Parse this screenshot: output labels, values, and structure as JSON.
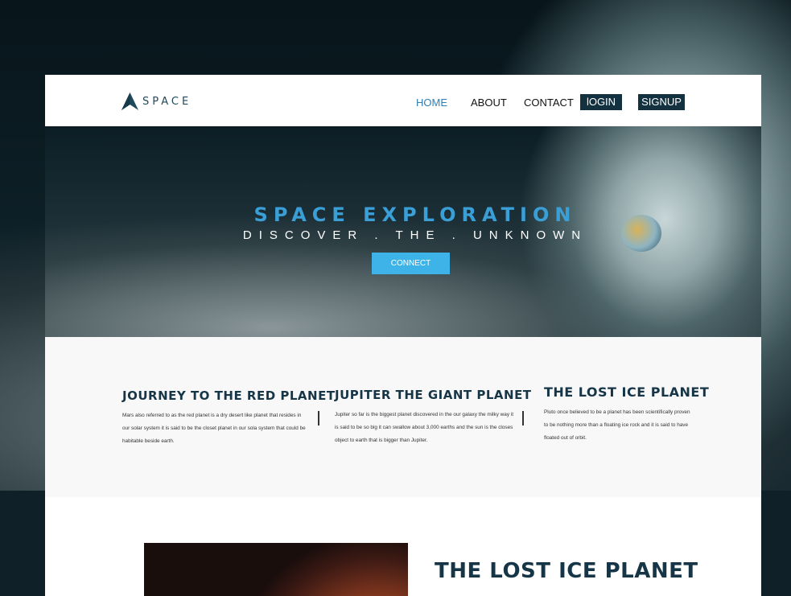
{
  "brand": {
    "logo_icon": "rocket-a-icon",
    "name": "SPACE",
    "color": "#20495a"
  },
  "nav": {
    "links": [
      "HOME",
      "ABOUT",
      "CONTACT"
    ],
    "active": "HOME",
    "login_label": "lOGIN",
    "signup_label": "SIGNUP"
  },
  "hero": {
    "title": "SPACE EXPLORATION",
    "subtitle": "DISCOVER . THE . UNKNOWN",
    "cta_label": "CONNECT"
  },
  "features": [
    {
      "title": "JOURNEY TO THE RED PLANET",
      "body": "Mars also referred to as the red planet is a dry desert like planet that resides in our solar system it is said to be the closet planet in our sola system that could be habitable beside earth."
    },
    {
      "title": "JUPITER THE GIANT PLANET",
      "body": "Jupiter so far is the biggest planet discovered in the our galaxy the milky way it is said to be so big it can swallow about 3,000 earths and the sun is the closes object to earth that is bigger than Jupiter."
    },
    {
      "title": "THE LOST ICE PLANET",
      "body": "Pluto once believed to be a planet has been scientifically proven to be nothing more than a floating ice rock and it is said to have floated out of orbit."
    }
  ],
  "lower": {
    "image_label": "mars-planet-image",
    "title": "THE LOST ICE PLANET"
  },
  "colors": {
    "accent": "#3eb3e8",
    "title_blue": "#3a9fd6",
    "dark_navy": "#143140",
    "heading": "#163547"
  }
}
